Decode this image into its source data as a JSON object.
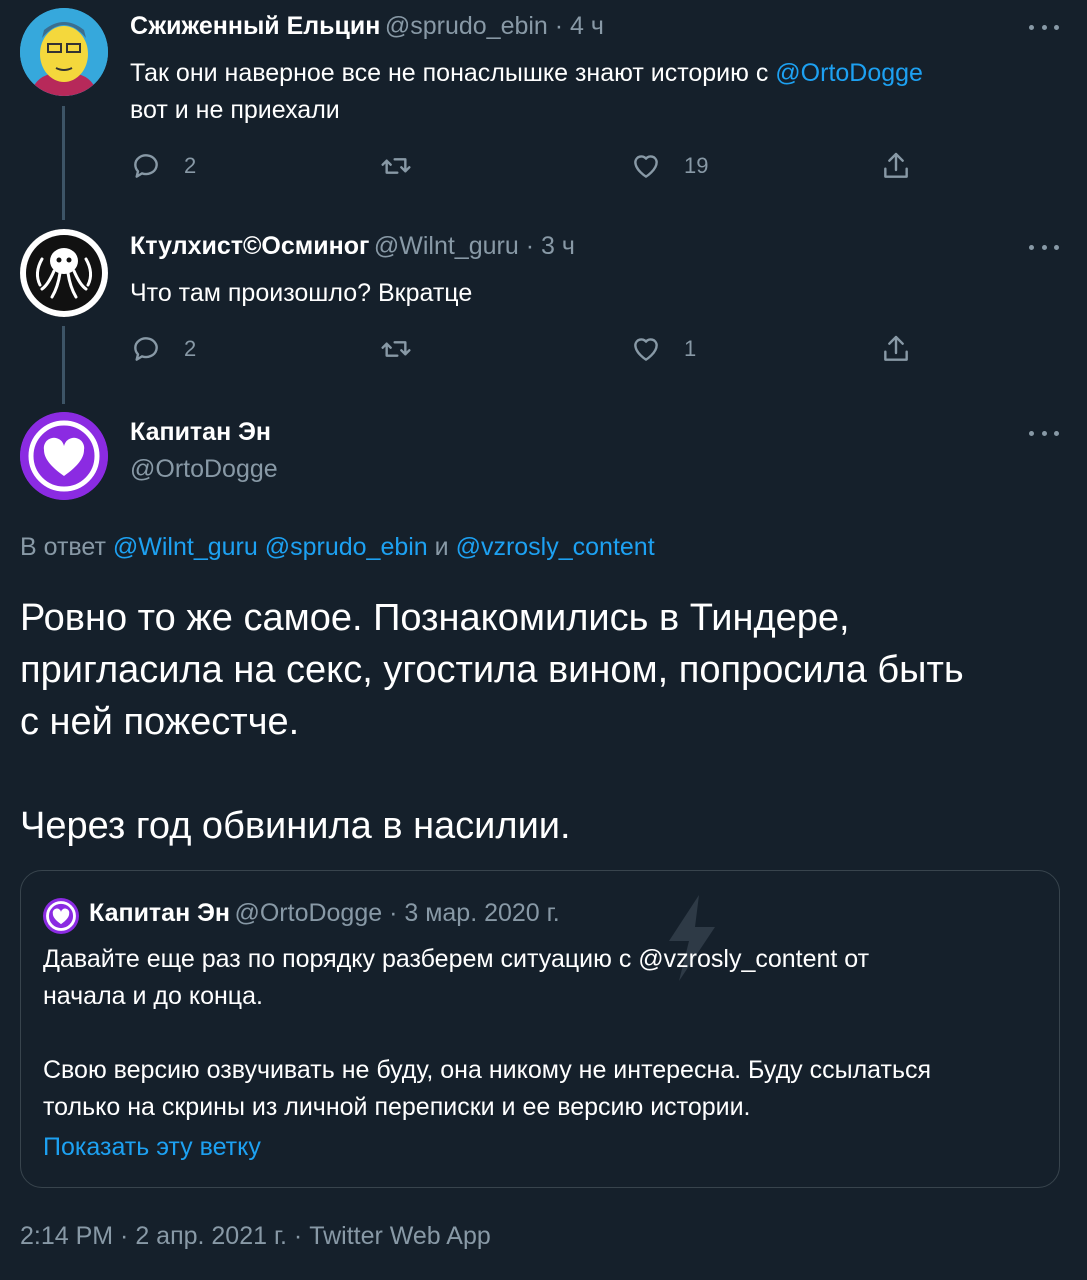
{
  "tweets": [
    {
      "name": "Сжиженный Ельцин",
      "handle_time": "@sprudo_ebin · 4 ч",
      "text_line1": "Так они наверное все не понаслышке знают историю с ",
      "mention": "@OrtoDogge",
      "text_line2": "вот и не приехали",
      "replies": "2",
      "likes": "19"
    },
    {
      "name": "Ктулхист©Осминог",
      "handle_time": "@Wilnt_guru · 3 ч",
      "text": "Что там произошло? Вкратце",
      "replies": "2",
      "likes": "1"
    }
  ],
  "main": {
    "name": "Капитан Эн",
    "handle": "@OrtoDogge",
    "reply_prefix": "В ответ ",
    "reply_mentions": "@Wilnt_guru @sprudo_ebin",
    "reply_and": " и ",
    "reply_mention_last": "@vzrosly_content",
    "line1": "Ровно то же самое. Познакомились в Тиндере,",
    "line2": "пригласила на секс, угостила вином, попросила быть",
    "line3": "с ней пожестче.",
    "line4": "Через год обвинила в насилии.",
    "timestamp": "2:14 PM · 2 апр. 2021 г. · Twitter Web App"
  },
  "quoted": {
    "name": "Капитан Эн",
    "handle_time": "@OrtoDogge · 3 мар. 2020 г.",
    "p1_start": "Давайте еще раз по порядку разберем ситуацию с ",
    "p1_mention": "@vzrosly_content",
    "p1_end": " от",
    "p1_line2": "начала и до конца.",
    "p2_line1": "Свою версию озвучивать не буду, она никому не интересна. Буду ссылаться",
    "p2_line2": "только на скрины из личной переписки и ее версию истории.",
    "show_thread": "Показать эту ветку"
  },
  "colors": {
    "background": "#15202b",
    "accent": "#1da1f2",
    "muted": "#8899a6",
    "avatar_purple": "#8b2be2"
  }
}
